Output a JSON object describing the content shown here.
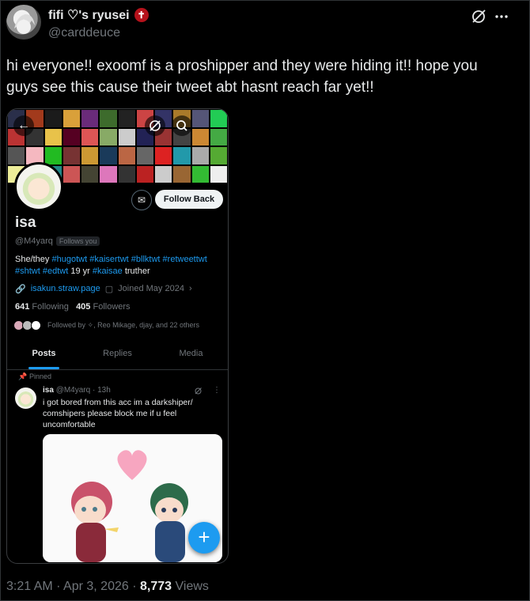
{
  "author": {
    "display_name": "fifi ♡'s ryusei",
    "handle": "@carddeuce",
    "badge_icon": "cross-icon"
  },
  "tweet": {
    "text": "hi everyone!! exoomf is a proshipper and they were hiding it!! hope you guys see this cause their tweet abt hasnt reach far yet!!"
  },
  "footer": {
    "time": "3:21 AM",
    "sep1": "·",
    "date": "Apr 3, 2026",
    "sep2": "·",
    "views_count": "8,773",
    "views_label": "Views"
  },
  "screenshot": {
    "profile": {
      "name": "isa",
      "handle": "@M4yarq",
      "follows_you": "Follows you",
      "bio": {
        "start": "She/they ",
        "t1": "#hugotwt",
        "t2": "#kaisertwt",
        "t3": "#bllktwt",
        "t4": "#retweettwt",
        "t5": "#shtwt",
        "t6": "#edtwt",
        "mid": " 19 yr ",
        "t7": "#kaisae",
        "end": " truther"
      },
      "link": "isakun.straw.page",
      "joined": "Joined May 2024",
      "following_count": "641",
      "following_label": "Following",
      "followers_count": "405",
      "followers_label": "Followers",
      "followed_by": "Followed by ✧, Reo Mikage, djay, and 22 others",
      "follow_back_label": "Follow Back"
    },
    "tabs": [
      "Posts",
      "Replies",
      "Media"
    ],
    "pinned_post": {
      "pinned_label": "Pinned",
      "name": "isa",
      "handle": "@M4yarq",
      "sep": "·",
      "time": "13h",
      "text": "i got bored from this acc im a darkshiper/ comshipers please block me if u feel uncomfortable"
    },
    "fab_label": "+"
  },
  "colors": {
    "accent": "#1d9bf0",
    "background": "#000000",
    "text": "#e7e9ea",
    "muted": "#71767b"
  }
}
